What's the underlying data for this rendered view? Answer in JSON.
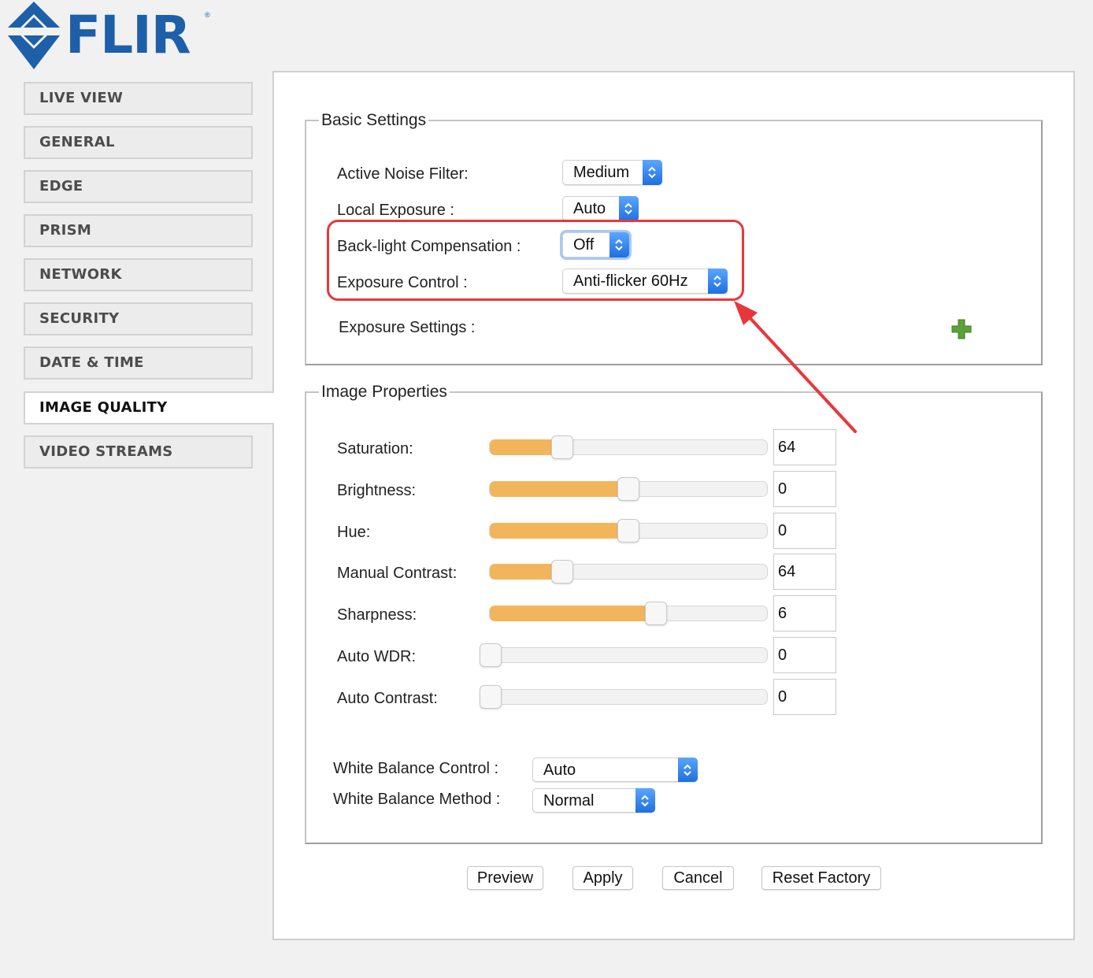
{
  "brand": {
    "logo_text": "FLIR",
    "registered_mark": "®"
  },
  "colors": {
    "brand_blue": "#1d5fa8",
    "slider_fill": "#f3b55c",
    "annotation_red": "#e8373b",
    "select_blue": "#2a7ff0"
  },
  "nav": {
    "items": [
      {
        "label": "LIVE VIEW"
      },
      {
        "label": "GENERAL"
      },
      {
        "label": "EDGE"
      },
      {
        "label": "PRISM"
      },
      {
        "label": "NETWORK"
      },
      {
        "label": "SECURITY"
      },
      {
        "label": "DATE & TIME"
      },
      {
        "label": "IMAGE QUALITY",
        "active": true
      },
      {
        "label": "VIDEO STREAMS"
      }
    ]
  },
  "basic_settings": {
    "legend": "Basic Settings",
    "active_noise_filter": {
      "label": "Active Noise Filter:",
      "value": "Medium"
    },
    "local_exposure": {
      "label": "Local Exposure :",
      "value": "Auto"
    },
    "backlight_compensation": {
      "label": "Back-light Compensation :",
      "value": "Off"
    },
    "exposure_control": {
      "label": "Exposure Control :",
      "value": "Anti-flicker 60Hz"
    },
    "exposure_settings": {
      "label": "Exposure Settings :",
      "expand_icon": "plus-icon"
    }
  },
  "image_properties": {
    "legend": "Image Properties",
    "sliders": [
      {
        "label": "Saturation:",
        "value": "64",
        "fill_fraction": 0.26
      },
      {
        "label": "Brightness:",
        "value": "0",
        "fill_fraction": 0.5
      },
      {
        "label": "Hue:",
        "value": "0",
        "fill_fraction": 0.5
      },
      {
        "label": "Manual Contrast:",
        "value": "64",
        "fill_fraction": 0.26
      },
      {
        "label": "Sharpness:",
        "value": "6",
        "fill_fraction": 0.6
      },
      {
        "label": "Auto WDR:",
        "value": "0",
        "fill_fraction": 0.0
      },
      {
        "label": "Auto Contrast:",
        "value": "0",
        "fill_fraction": 0.0
      }
    ],
    "white_balance_control": {
      "label": "White Balance Control :",
      "value": "Auto"
    },
    "white_balance_method": {
      "label": "White Balance Method :",
      "value": "Normal"
    }
  },
  "buttons": {
    "preview": "Preview",
    "apply": "Apply",
    "cancel": "Cancel",
    "reset_factory": "Reset Factory"
  }
}
